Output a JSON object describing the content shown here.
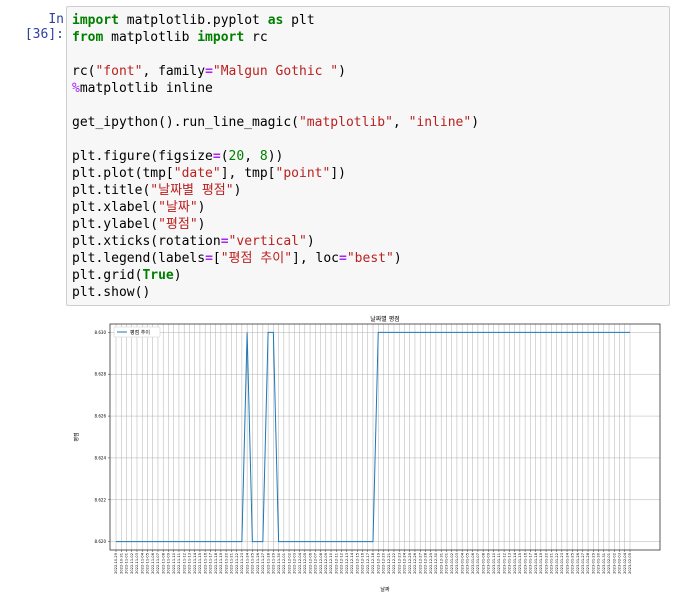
{
  "cell": {
    "prompt": "In [36]:",
    "code_lines": [
      [
        {
          "t": "import",
          "c": "kw"
        },
        {
          "t": " matplotlib.pyplot "
        },
        {
          "t": "as",
          "c": "kw"
        },
        {
          "t": " plt"
        }
      ],
      [
        {
          "t": "from",
          "c": "kw"
        },
        {
          "t": " matplotlib "
        },
        {
          "t": "import",
          "c": "kw"
        },
        {
          "t": " rc"
        }
      ],
      [],
      [
        {
          "t": "rc("
        },
        {
          "t": "\"font\"",
          "c": "str"
        },
        {
          "t": ", family"
        },
        {
          "t": "=",
          "c": "op"
        },
        {
          "t": "\"Malgun Gothic \"",
          "c": "str"
        },
        {
          "t": ")"
        }
      ],
      [
        {
          "t": "%",
          "c": "magic"
        },
        {
          "t": "matplotlib inline"
        }
      ],
      [],
      [
        {
          "t": "get_ipython().run_line_magic("
        },
        {
          "t": "\"matplotlib\"",
          "c": "str"
        },
        {
          "t": ", "
        },
        {
          "t": "\"inline\"",
          "c": "str"
        },
        {
          "t": ")"
        }
      ],
      [],
      [
        {
          "t": "plt.figure(figsize"
        },
        {
          "t": "=",
          "c": "op"
        },
        {
          "t": "("
        },
        {
          "t": "20",
          "c": "num"
        },
        {
          "t": ", "
        },
        {
          "t": "8",
          "c": "num"
        },
        {
          "t": "))"
        }
      ],
      [
        {
          "t": "plt.plot(tmp["
        },
        {
          "t": "\"date\"",
          "c": "str"
        },
        {
          "t": "], tmp["
        },
        {
          "t": "\"point\"",
          "c": "str"
        },
        {
          "t": "])"
        }
      ],
      [
        {
          "t": "plt.title("
        },
        {
          "t": "\"날짜별 평점\"",
          "c": "str"
        },
        {
          "t": ")"
        }
      ],
      [
        {
          "t": "plt.xlabel("
        },
        {
          "t": "\"날짜\"",
          "c": "str"
        },
        {
          "t": ")"
        }
      ],
      [
        {
          "t": "plt.ylabel("
        },
        {
          "t": "\"평점\"",
          "c": "str"
        },
        {
          "t": ")"
        }
      ],
      [
        {
          "t": "plt.xticks(rotation"
        },
        {
          "t": "=",
          "c": "op"
        },
        {
          "t": "\"vertical\"",
          "c": "str"
        },
        {
          "t": ")"
        }
      ],
      [
        {
          "t": "plt.legend(labels"
        },
        {
          "t": "=",
          "c": "op"
        },
        {
          "t": "["
        },
        {
          "t": "\"평점 추이\"",
          "c": "str"
        },
        {
          "t": "], loc"
        },
        {
          "t": "=",
          "c": "op"
        },
        {
          "t": "\"best\"",
          "c": "str"
        },
        {
          "t": ")"
        }
      ],
      [
        {
          "t": "plt.grid("
        },
        {
          "t": "True",
          "c": "kw"
        },
        {
          "t": ")"
        }
      ],
      [
        {
          "t": "plt.show()"
        }
      ]
    ]
  },
  "chart_data": {
    "type": "line",
    "title": "날짜별 평점",
    "xlabel": "날짜",
    "ylabel": "평점",
    "legend": {
      "labels": [
        "평점 추이"
      ],
      "loc": "top-left"
    },
    "grid": true,
    "ylim": [
      8.6196,
      8.6304
    ],
    "yticks": [
      8.62,
      8.622,
      8.624,
      8.626,
      8.628,
      8.63
    ],
    "line_color": "#1f77b4",
    "series": [
      {
        "name": "평점 추이",
        "x": [
          "2022-10-29",
          "2022-10-31",
          "2022-11-01",
          "2022-11-02",
          "2022-11-03",
          "2022-11-04",
          "2022-11-05",
          "2022-11-06",
          "2022-11-07",
          "2022-11-08",
          "2022-11-09",
          "2022-11-10",
          "2022-11-11",
          "2022-11-12",
          "2022-11-13",
          "2022-11-14",
          "2022-11-15",
          "2022-11-16",
          "2022-11-17",
          "2022-11-18",
          "2022-11-19",
          "2022-11-20",
          "2022-11-21",
          "2022-11-22",
          "2022-11-23",
          "2022-11-24",
          "2022-11-25",
          "2022-11-26",
          "2022-11-27",
          "2022-11-28",
          "2022-11-29",
          "2022-11-30",
          "2022-12-01",
          "2022-12-02",
          "2022-12-03",
          "2022-12-04",
          "2022-12-05",
          "2022-12-06",
          "2022-12-07",
          "2022-12-08",
          "2022-12-09",
          "2022-12-10",
          "2022-12-11",
          "2022-12-12",
          "2022-12-13",
          "2022-12-14",
          "2022-12-15",
          "2022-12-16",
          "2022-12-17",
          "2022-12-18",
          "2022-12-19",
          "2022-12-20",
          "2022-12-21",
          "2022-12-22",
          "2022-12-23",
          "2022-12-24",
          "2022-12-25",
          "2022-12-26",
          "2022-12-27",
          "2022-12-28",
          "2022-12-29",
          "2022-12-30",
          "2022-12-31",
          "2023-01-01",
          "2023-01-02",
          "2023-01-03",
          "2023-01-04",
          "2023-01-05",
          "2023-01-06",
          "2023-01-07",
          "2023-01-08",
          "2023-01-09",
          "2023-01-10",
          "2023-01-11",
          "2023-01-12",
          "2023-01-13",
          "2023-01-14",
          "2023-01-15",
          "2023-01-16",
          "2023-01-17",
          "2023-01-18",
          "2023-01-19",
          "2023-01-20",
          "2023-01-21",
          "2023-01-22",
          "2023-01-23",
          "2023-01-24",
          "2023-01-25",
          "2023-01-26",
          "2023-01-27",
          "2023-01-28",
          "2023-01-29",
          "2023-01-30",
          "2023-01-31",
          "2023-02-01",
          "2023-02-02",
          "2023-02-03",
          "2023-02-04",
          "2023-02-05"
        ],
        "values": [
          8.62,
          8.62,
          8.62,
          8.62,
          8.62,
          8.62,
          8.62,
          8.62,
          8.62,
          8.62,
          8.62,
          8.62,
          8.62,
          8.62,
          8.62,
          8.62,
          8.62,
          8.62,
          8.62,
          8.62,
          8.62,
          8.62,
          8.62,
          8.62,
          8.62,
          8.63,
          8.62,
          8.62,
          8.62,
          8.63,
          8.63,
          8.62,
          8.62,
          8.62,
          8.62,
          8.62,
          8.62,
          8.62,
          8.62,
          8.62,
          8.62,
          8.62,
          8.62,
          8.62,
          8.62,
          8.62,
          8.62,
          8.62,
          8.62,
          8.62,
          8.63,
          8.63,
          8.63,
          8.63,
          8.63,
          8.63,
          8.63,
          8.63,
          8.63,
          8.63,
          8.63,
          8.63,
          8.63,
          8.63,
          8.63,
          8.63,
          8.63,
          8.63,
          8.63,
          8.63,
          8.63,
          8.63,
          8.63,
          8.63,
          8.63,
          8.63,
          8.63,
          8.63,
          8.63,
          8.63,
          8.63,
          8.63,
          8.63,
          8.63,
          8.63,
          8.63,
          8.63,
          8.63,
          8.63,
          8.63,
          8.63,
          8.63,
          8.63,
          8.63,
          8.63,
          8.63,
          8.63,
          8.63,
          8.63
        ]
      }
    ]
  }
}
